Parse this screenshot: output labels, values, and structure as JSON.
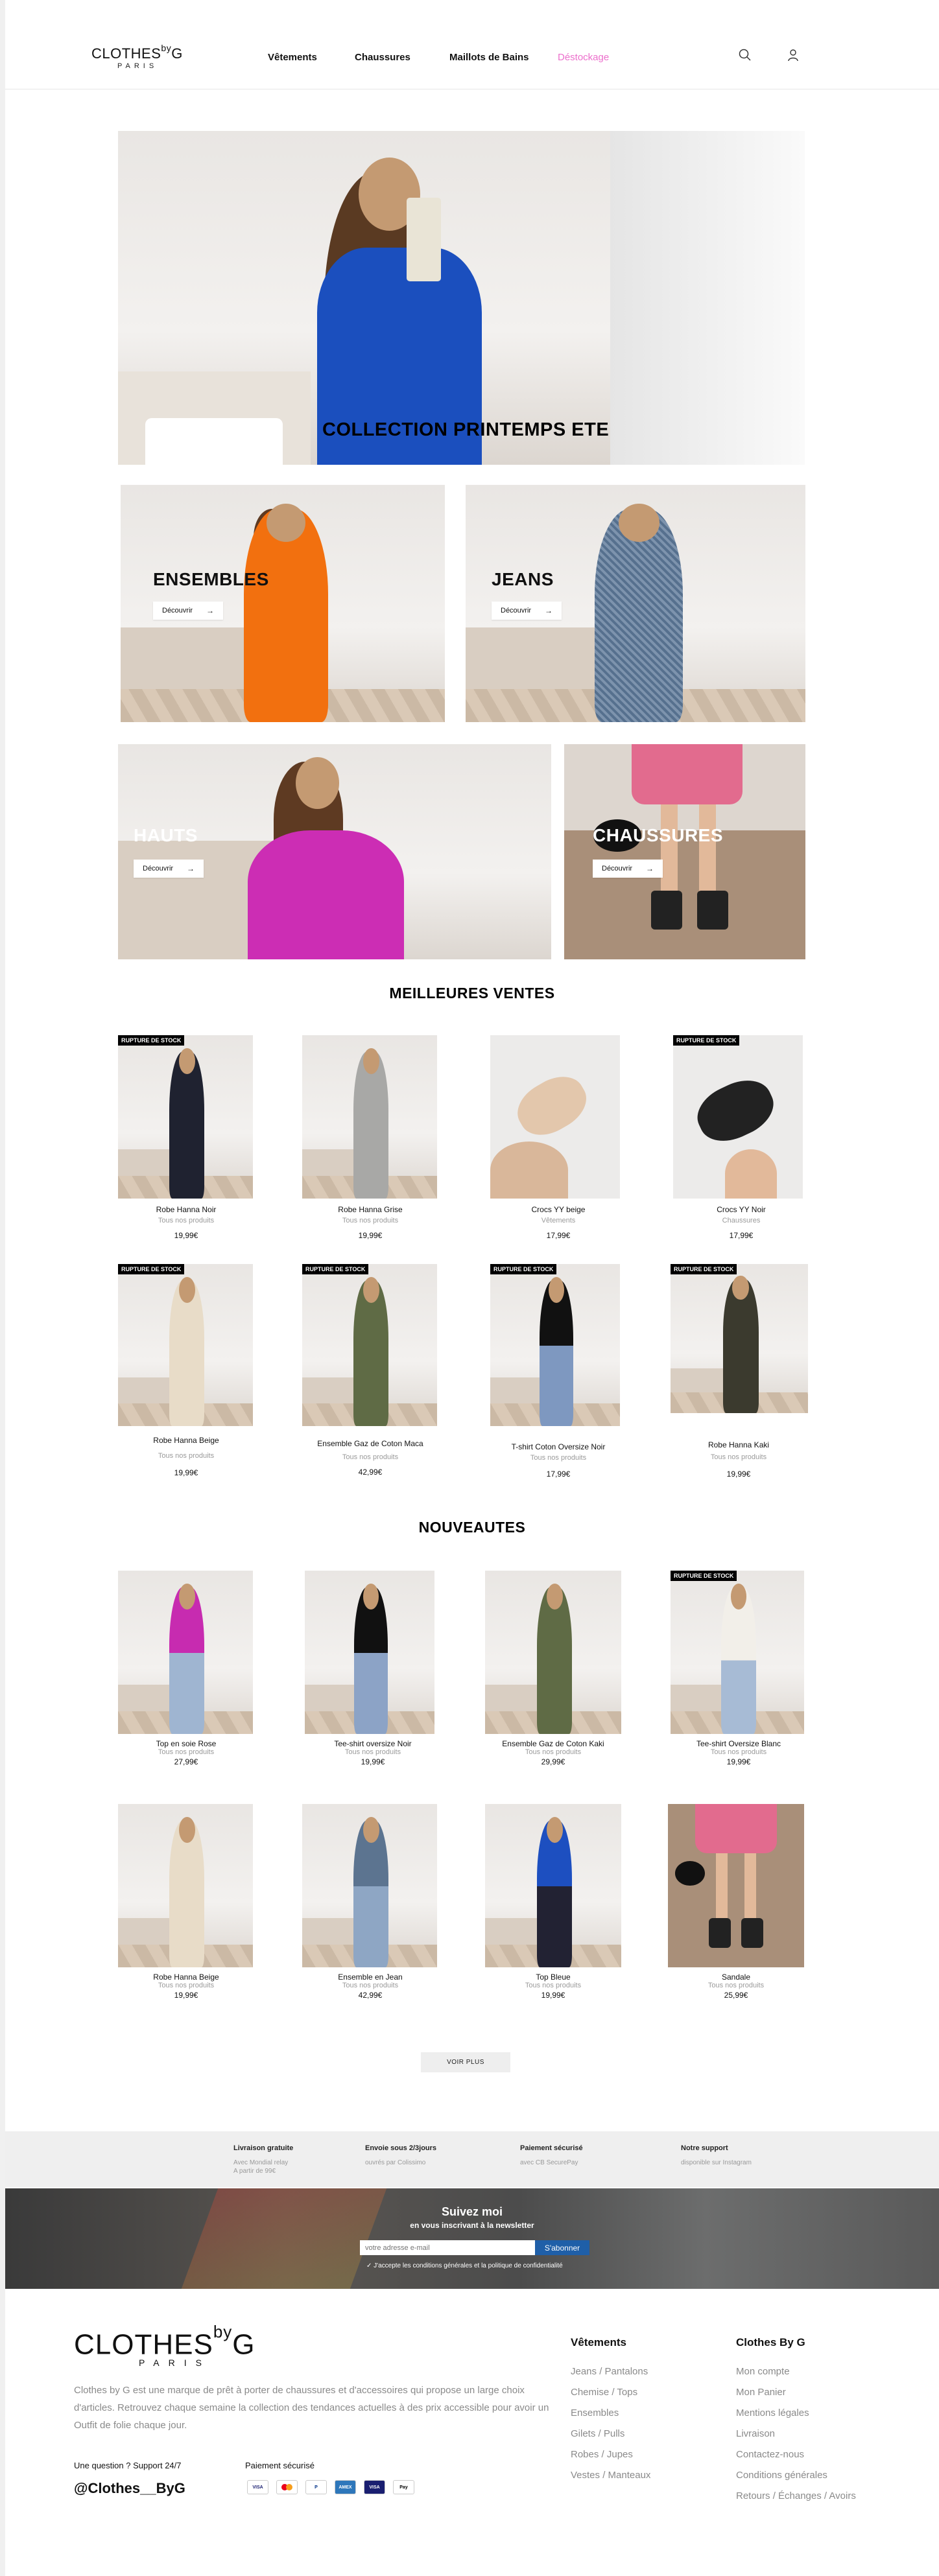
{
  "header": {
    "logo_main": "CLOTHES",
    "logo_by": "by",
    "logo_g": "G",
    "logo_sub": "PARIS",
    "nav": [
      "Vêtements",
      "Chaussures",
      "Maillots de Bains",
      "Déstockage"
    ]
  },
  "hero": {
    "title": "COLLECTION PRINTEMPS ETE"
  },
  "categories": [
    {
      "title": "ENSEMBLES",
      "button": "Découvrir"
    },
    {
      "title": "JEANS",
      "button": "Découvrir"
    },
    {
      "title": "HAUTS",
      "button": "Découvrir"
    },
    {
      "title": "CHAUSSURES",
      "button": "Découvrir"
    }
  ],
  "bestsellers": {
    "title": "MEILLEURES VENTES",
    "items": [
      {
        "name": "Robe Hanna Noir",
        "category": "Tous nos produits",
        "price": "19,99€",
        "badge": "RUPTURE DE STOCK"
      },
      {
        "name": "Robe Hanna Grise",
        "category": "Tous nos produits",
        "price": "19,99€",
        "badge": ""
      },
      {
        "name": "Crocs YY beige",
        "category": "Vêtements",
        "price": "17,99€",
        "badge": ""
      },
      {
        "name": "Crocs YY Noir",
        "category": "Chaussures",
        "price": "17,99€",
        "badge": "RUPTURE DE STOCK"
      },
      {
        "name": "Robe Hanna Beige",
        "category": "Tous nos produits",
        "price": "19,99€",
        "badge": "RUPTURE DE STOCK"
      },
      {
        "name": "Ensemble Gaz de Coton Maca",
        "category": "Tous nos produits",
        "price": "42,99€",
        "badge": "RUPTURE DE STOCK"
      },
      {
        "name": "T-shirt Coton Oversize Noir",
        "category": "Tous nos produits",
        "price": "17,99€",
        "badge": "RUPTURE DE STOCK"
      },
      {
        "name": "Robe Hanna Kaki",
        "category": "Tous nos produits",
        "price": "19,99€",
        "badge": "RUPTURE DE STOCK"
      }
    ]
  },
  "new_arrivals": {
    "title": "NOUVEAUTES",
    "items": [
      {
        "name": "Top en soie Rose",
        "category": "Tous nos produits",
        "price": "27,99€",
        "badge": ""
      },
      {
        "name": "Tee-shirt oversize Noir",
        "category": "Tous nos produits",
        "price": "19,99€",
        "badge": ""
      },
      {
        "name": "Ensemble Gaz de Coton Kaki",
        "category": "Tous nos produits",
        "price": "29,99€",
        "badge": ""
      },
      {
        "name": "Tee-shirt Oversize Blanc",
        "category": "Tous nos produits",
        "price": "19,99€",
        "badge": "RUPTURE DE STOCK"
      },
      {
        "name": "Robe Hanna Beige",
        "category": "Tous nos produits",
        "price": "19,99€",
        "badge": ""
      },
      {
        "name": "Ensemble en Jean",
        "category": "Tous nos produits",
        "price": "42,99€",
        "badge": ""
      },
      {
        "name": "Top Bleue",
        "category": "Tous nos produits",
        "price": "19,99€",
        "badge": ""
      },
      {
        "name": "Sandale",
        "category": "Tous nos produits",
        "price": "25,99€",
        "badge": ""
      }
    ],
    "more_button": "VOIR PLUS"
  },
  "features": [
    {
      "title": "Livraison gratuite",
      "sub1": "Avec Mondial relay",
      "sub2": "A partir de 99€"
    },
    {
      "title": "Envoie sous 2/3jours",
      "sub1": "ouvrés par Colissimo",
      "sub2": ""
    },
    {
      "title": "Paiement sécurisé",
      "sub1": "avec CB SecurePay",
      "sub2": ""
    },
    {
      "title": "Notre support",
      "sub1": "disponible sur Instagram",
      "sub2": ""
    }
  ],
  "newsletter": {
    "title": "Suivez moi",
    "subtitle": "en vous inscrivant à la newsletter",
    "placeholder": "votre adresse e-mail",
    "button": "S'abonner",
    "consent": "J'accepte les conditions générales et la politique de confidentialité"
  },
  "footer": {
    "logo_main": "CLOTHES",
    "logo_by": "by",
    "logo_g": "G",
    "logo_sub": "PARIS",
    "description": "Clothes by G est une marque de prêt à porter de chaussures et d'accessoires qui propose un large choix d'articles. Retrouvez chaque semaine la collection des tendances actuelles à des prix accessible pour avoir un Outfit de folie chaque jour.",
    "support": "Une question ? Support 24/7",
    "handle": "@Clothes__ByG",
    "payment": "Paiement sécurisé",
    "col1_title": "Vêtements",
    "col1": [
      "Jeans / Pantalons",
      "Chemise / Tops",
      "Ensembles",
      "Gilets / Pulls",
      "Robes / Jupes",
      "Vestes / Manteaux"
    ],
    "col2_title": "Clothes By G",
    "col2": [
      "Mon compte",
      "Mon Panier",
      "Mentions légales",
      "Livraison",
      "Contactez-nous",
      "Conditions générales",
      "Retours / Échanges / Avoirs"
    ]
  },
  "colors": {
    "accent_pink": "#ec6fcc",
    "button_blue": "#1f5fa8"
  }
}
